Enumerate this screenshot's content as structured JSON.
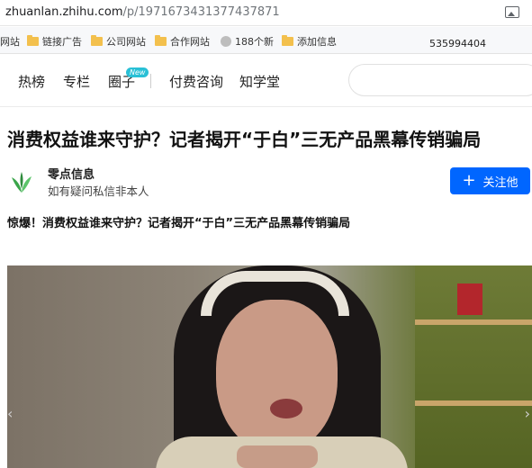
{
  "browser": {
    "url_host": "zhuanlan.zhihu.com",
    "url_path": "/p/1971673431377437871"
  },
  "bookmarks": {
    "items": [
      {
        "label": "网站",
        "icon": "none"
      },
      {
        "label": "链接广告",
        "icon": "folder-icon"
      },
      {
        "label": "公司网站",
        "icon": "folder-icon"
      },
      {
        "label": "合作网站",
        "icon": "folder-icon"
      },
      {
        "label": "188个新",
        "icon": "globe-icon"
      },
      {
        "label": "添加信息",
        "icon": "folder-icon"
      }
    ],
    "number": "535994404"
  },
  "nav": {
    "tabs": [
      "热榜",
      "专栏",
      "圈子",
      "付费咨询",
      "知学堂"
    ],
    "new_badge": "New",
    "search_placeholder": ""
  },
  "article": {
    "title": "消费权益谁来守护？记者揭开“于白”三无产品黑幕传销骗局",
    "author_name": "零点信息",
    "author_desc": "如有疑问私信非本人",
    "follow_label": "关注他",
    "lead": "惊爆！消费权益谁来守护？记者揭开“于白”三无产品黑幕传销骗局"
  },
  "colors": {
    "follow_bg": "#0066ff",
    "new_badge": "#29c0d6",
    "folder": "#f3c04d"
  }
}
